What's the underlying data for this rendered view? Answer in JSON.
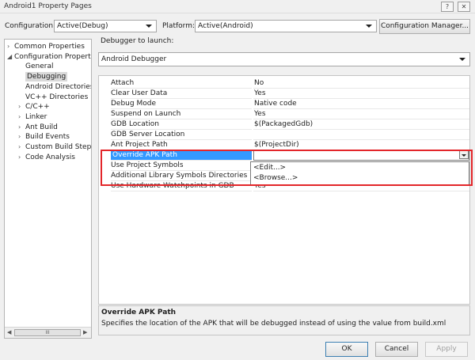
{
  "window": {
    "title": "Android1 Property Pages",
    "help_glyph": "?",
    "close_glyph": "✕"
  },
  "config_bar": {
    "configuration_label": "Configuration:",
    "configuration_value": "Active(Debug)",
    "platform_label": "Platform:",
    "platform_value": "Active(Android)",
    "config_manager_button": "Configuration Manager..."
  },
  "tree": {
    "items": [
      {
        "label": "Common Properties",
        "chevron": "›",
        "level": 0
      },
      {
        "label": "Configuration Properties",
        "chevron": "◢",
        "level": 0
      },
      {
        "label": "General",
        "chevron": "",
        "level": 1
      },
      {
        "label": "Debugging",
        "chevron": "",
        "level": 1,
        "selected": true
      },
      {
        "label": "Android Directories",
        "chevron": "",
        "level": 1
      },
      {
        "label": "VC++ Directories",
        "chevron": "",
        "level": 1
      },
      {
        "label": "C/C++",
        "chevron": "›",
        "level": 1
      },
      {
        "label": "Linker",
        "chevron": "›",
        "level": 1
      },
      {
        "label": "Ant Build",
        "chevron": "›",
        "level": 1
      },
      {
        "label": "Build Events",
        "chevron": "›",
        "level": 1
      },
      {
        "label": "Custom Build Step",
        "chevron": "›",
        "level": 1
      },
      {
        "label": "Code Analysis",
        "chevron": "›",
        "level": 1
      }
    ],
    "scroll_left": "◀",
    "scroll_right": "▶",
    "scroll_thumb": "III"
  },
  "debugger": {
    "label": "Debugger to launch:",
    "value": "Android Debugger"
  },
  "properties": [
    {
      "name": "Attach",
      "value": "No"
    },
    {
      "name": "Clear User Data",
      "value": "Yes"
    },
    {
      "name": "Debug Mode",
      "value": "Native code"
    },
    {
      "name": "Suspend on Launch",
      "value": "Yes"
    },
    {
      "name": "GDB Location",
      "value": "$(PackagedGdb)"
    },
    {
      "name": "GDB Server Location",
      "value": ""
    },
    {
      "name": "Ant Project Path",
      "value": "$(ProjectDir)"
    },
    {
      "name": "Override APK Path",
      "value": "",
      "selected": true
    },
    {
      "name": "Use Project Symbols",
      "value": ""
    },
    {
      "name": "Additional Library Symbols Directories",
      "value": ""
    },
    {
      "name": "Use Hardware Watchpoints in GDB",
      "value": "Yes"
    }
  ],
  "dropdown_options": [
    "<Edit...>",
    "<Browse...>"
  ],
  "description": {
    "title": "Override APK Path",
    "text": "Specifies the location of the APK that will be debugged instead of using the value from build.xml"
  },
  "buttons": {
    "ok": "OK",
    "cancel": "Cancel",
    "apply": "Apply"
  },
  "colors": {
    "selection": "#3399ff",
    "highlight_box": "#e3262a",
    "tree_selected": "#d9d9d9"
  }
}
